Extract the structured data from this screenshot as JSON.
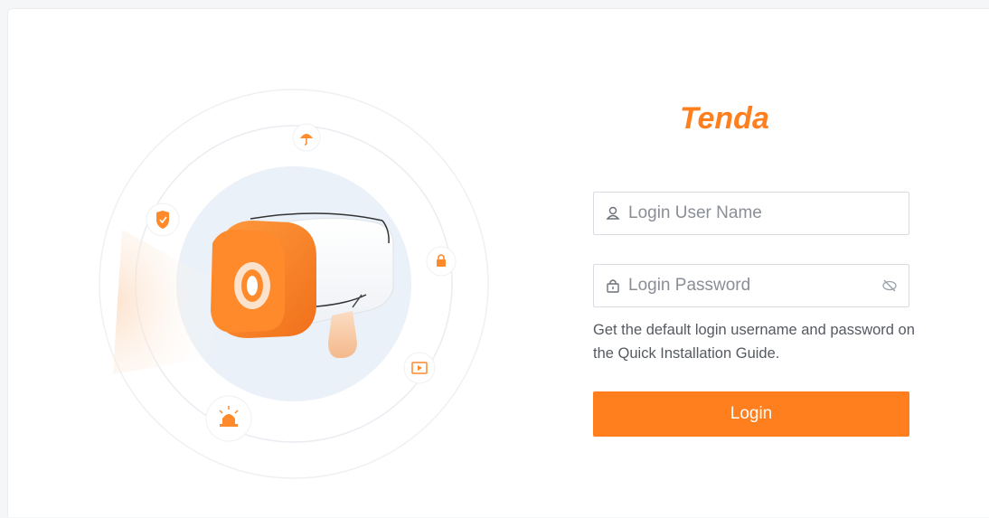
{
  "brand": {
    "logo_text": "Tenda",
    "accent_color": "#ff7f1f"
  },
  "form": {
    "username": {
      "placeholder": "Login User Name",
      "value": "",
      "icon": "user-icon"
    },
    "password": {
      "placeholder": "Login Password",
      "value": "",
      "icon": "lock-icon",
      "toggle_icon": "eye-hidden-icon"
    },
    "hint": "Get the default login username and password on the Quick Installation Guide.",
    "login_label": "Login"
  },
  "illustration": {
    "feature_icons": [
      "umbrella-icon",
      "shield-check-icon",
      "lock-icon",
      "video-icon",
      "alarm-light-icon"
    ],
    "central_image": "security-camera-illustration"
  }
}
